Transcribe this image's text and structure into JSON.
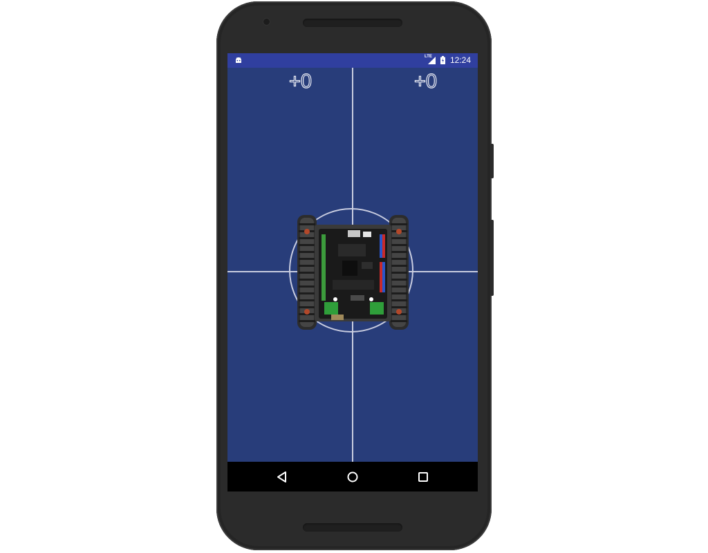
{
  "status_bar": {
    "time": "12:24",
    "network_label": "LTE",
    "icons": [
      "android-icon",
      "signal-icon",
      "battery-icon"
    ]
  },
  "app": {
    "left_counter": "+0",
    "right_counter": "+0",
    "robot_image": "tracked-robot-chassis-with-controller-board"
  },
  "nav_bar": {
    "buttons": [
      "back-icon",
      "home-icon",
      "recents-icon"
    ]
  },
  "colors": {
    "status_bar": "#303f9f",
    "app_background": "#283d7a",
    "divider": "#c9cde0",
    "nav_bar": "#000000",
    "phone_body": "#2b2b2b"
  }
}
